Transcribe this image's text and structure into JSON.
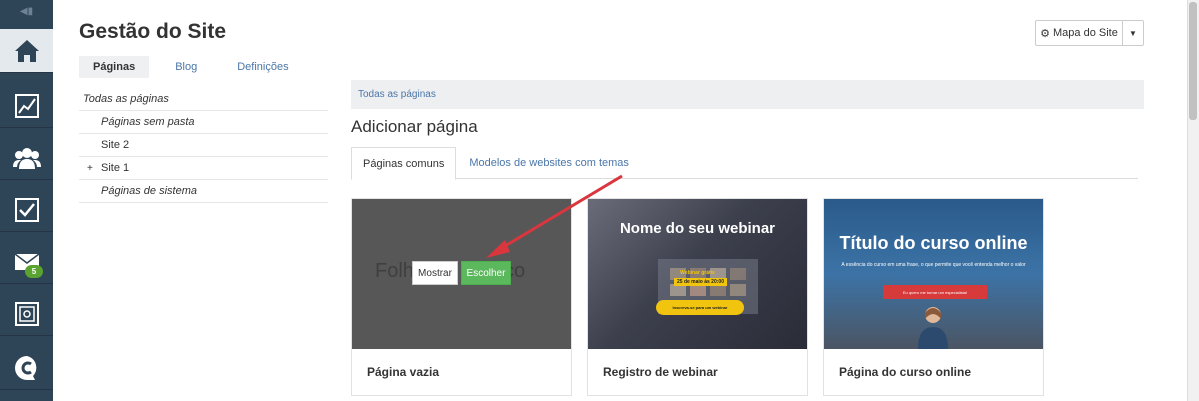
{
  "sidebar": {
    "items": [
      {
        "icon": "home-icon"
      },
      {
        "icon": "chart-icon"
      },
      {
        "icon": "users-icon"
      },
      {
        "icon": "checkbox-icon"
      },
      {
        "icon": "mail-icon",
        "badge": "5"
      },
      {
        "icon": "safe-icon"
      },
      {
        "icon": "chat-logo-icon"
      }
    ]
  },
  "header": {
    "title": "Gestão do Site",
    "sitemap_label": "Mapa do Site"
  },
  "top_tabs": [
    "Páginas",
    "Blog",
    "Definições"
  ],
  "tree": {
    "items": [
      "Todas as páginas",
      "Páginas sem pasta",
      "Site 2",
      "Site 1",
      "Páginas de sistema"
    ],
    "expand_symbol": "+"
  },
  "breadcrumb": "Todas as páginas",
  "main": {
    "title": "Adicionar página",
    "tabs": [
      "Páginas comuns",
      "Modelos de websites com temas"
    ]
  },
  "cards": [
    {
      "label": "Página vazia",
      "preview_text": "Folha em branco",
      "show_label": "Mostrar",
      "choose_label": "Escolher"
    },
    {
      "label": "Registro de webinar",
      "preview_title": "Nome do seu webinar",
      "preview_sub": "Webinar grátis",
      "preview_date": "25 de maio às 20:00",
      "preview_button": "Inscreva-se para um webinar"
    },
    {
      "label": "Página do curso online",
      "preview_title": "Título do curso online",
      "preview_sub": "A essência do curso em uma frase, o que permite que você entenda melhor o valor",
      "preview_button": "Eu quero me tornar um especialista!"
    }
  ],
  "colors": {
    "sidebar": "#2e4457",
    "accent_green": "#5cb85c",
    "link_blue": "#4a76a8",
    "arrow_red": "#d9363e"
  }
}
